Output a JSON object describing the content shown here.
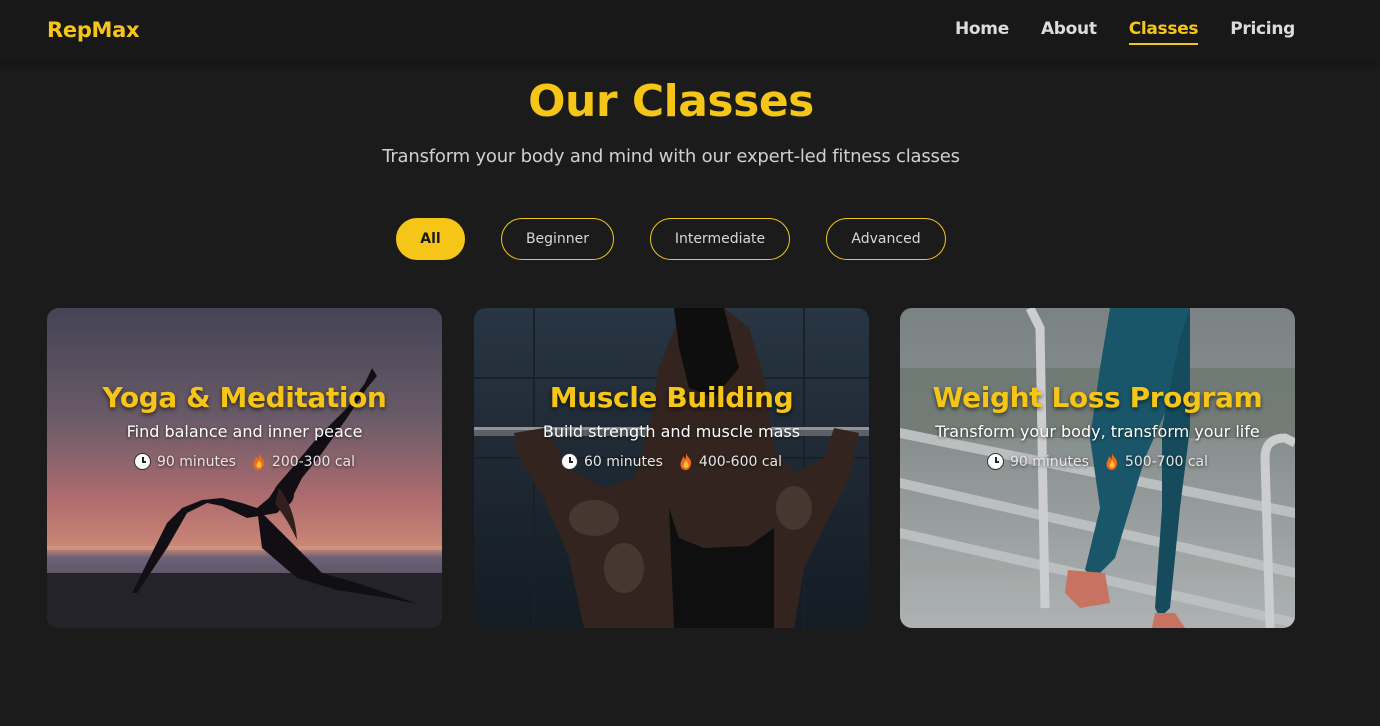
{
  "nav": {
    "brand": "RepMax",
    "links": [
      {
        "label": "Home",
        "active": false
      },
      {
        "label": "About",
        "active": false
      },
      {
        "label": "Classes",
        "active": true
      },
      {
        "label": "Pricing",
        "active": false
      }
    ]
  },
  "header": {
    "title": "Our Classes",
    "subtitle": "Transform your body and mind with our expert-led fitness classes"
  },
  "filters": [
    {
      "label": "All",
      "active": true
    },
    {
      "label": "Beginner",
      "active": false
    },
    {
      "label": "Intermediate",
      "active": false
    },
    {
      "label": "Advanced",
      "active": false
    }
  ],
  "classes": [
    {
      "title": "Yoga & Meditation",
      "description": "Find balance and inner peace",
      "duration": "90 minutes",
      "calories": "200-300 cal"
    },
    {
      "title": "Muscle Building",
      "description": "Build strength and muscle mass",
      "duration": "60 minutes",
      "calories": "400-600 cal"
    },
    {
      "title": "Weight Loss Program",
      "description": "Transform your body, transform your life",
      "duration": "90 minutes",
      "calories": "500-700 cal"
    }
  ],
  "icons": {
    "duration": "clock-icon",
    "calories": "fire-icon"
  },
  "colors": {
    "accent": "#f5c518",
    "background": "#1b1b1b",
    "navbar": "#181818"
  }
}
